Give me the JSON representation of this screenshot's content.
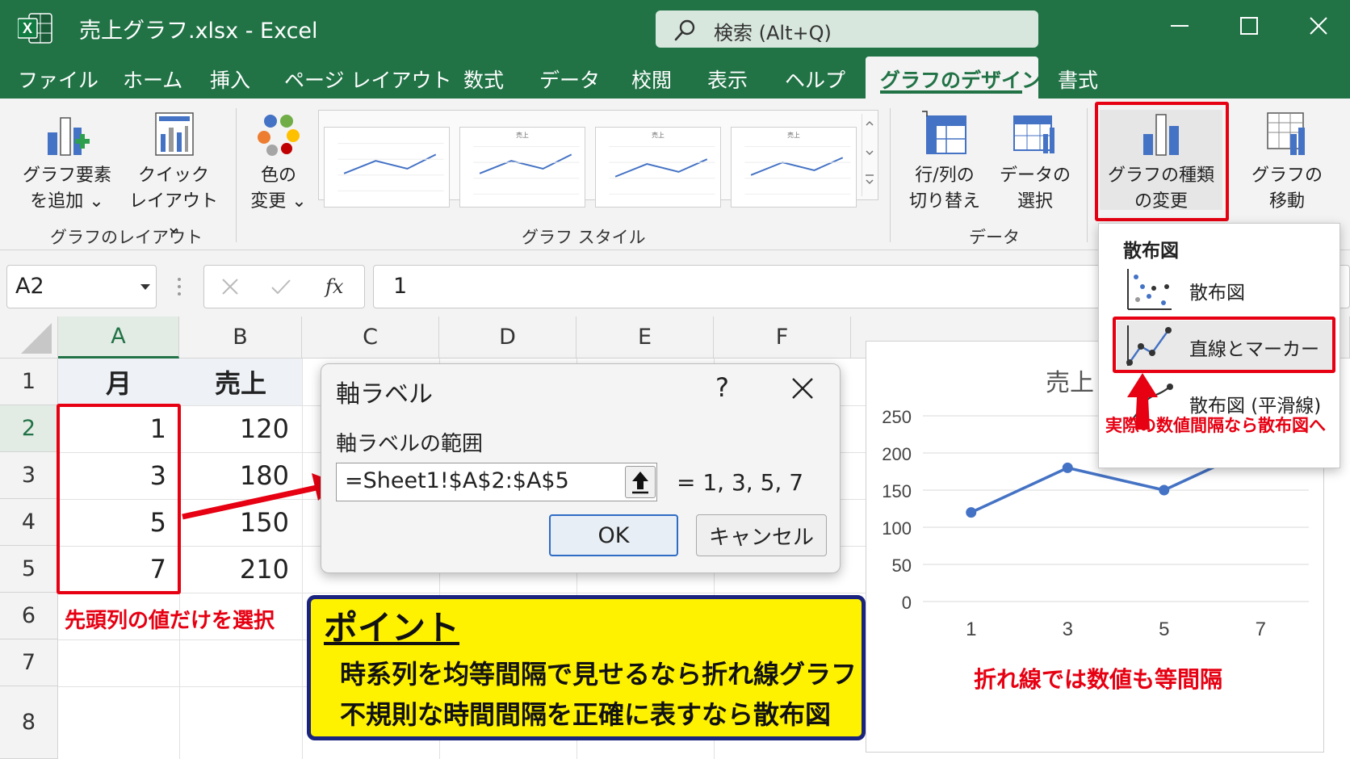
{
  "window": {
    "title": "売上グラフ.xlsx  -  Excel",
    "search_placeholder": "検索 (Alt+Q)"
  },
  "tabs": [
    {
      "label": "ファイル"
    },
    {
      "label": "ホーム"
    },
    {
      "label": "挿入"
    },
    {
      "label": "ページ レイアウト"
    },
    {
      "label": "数式"
    },
    {
      "label": "データ"
    },
    {
      "label": "校閲"
    },
    {
      "label": "表示"
    },
    {
      "label": "ヘルプ"
    },
    {
      "label": "グラフのデザイン",
      "active": true
    },
    {
      "label": "書式"
    }
  ],
  "ribbon": {
    "add_element": {
      "line1": "グラフ要素",
      "line2": "を追加 ⌄"
    },
    "quick_layout": {
      "line1": "クイック",
      "line2": "レイアウト ⌄"
    },
    "change_colors": {
      "line1": "色の",
      "line2": "変更 ⌄"
    },
    "style_thumb_title": "売上",
    "switch_row_col": {
      "line1": "行/列の",
      "line2": "切り替え"
    },
    "select_data": {
      "line1": "データの",
      "line2": "選択"
    },
    "change_chart_type": {
      "line1": "グラフの種類",
      "line2": "の変更"
    },
    "move_chart": {
      "line1": "グラフの",
      "line2": "移動"
    },
    "group_layout": "グラフのレイアウト",
    "group_styles": "グラフ スタイル",
    "group_data": "データ"
  },
  "formula_bar": {
    "name_box": "A2",
    "formula": "1"
  },
  "sheet": {
    "columns": [
      "A",
      "B",
      "C",
      "D",
      "E",
      "F"
    ],
    "rows": [
      "1",
      "2",
      "3",
      "4",
      "5",
      "6",
      "7",
      "8"
    ],
    "header": {
      "A": "月",
      "B": "売上"
    },
    "data": [
      {
        "A": "1",
        "B": "120"
      },
      {
        "A": "3",
        "B": "180"
      },
      {
        "A": "5",
        "B": "150"
      },
      {
        "A": "7",
        "B": "210"
      }
    ]
  },
  "dialog": {
    "title": "軸ラベル",
    "help": "?",
    "label": "軸ラベルの範囲",
    "range_value": "=Sheet1!$A$2:$A$5",
    "preview": "= 1, 3, 5, 7",
    "ok": "OK",
    "cancel": "キャンセル"
  },
  "annotations": {
    "select_note": "先頭列の値だけを選択",
    "scatter_note": "実際の数値間隔なら散布図へ",
    "line_note": "折れ線では数値も等間隔",
    "point_title": "ポイント",
    "point_line1": "時系列を均等間隔で見せるなら折れ線グラフ",
    "point_line2": "不規則な時間間隔を正確に表すなら散布図"
  },
  "dropdown": {
    "header": "散布図",
    "items": [
      {
        "label": "散布図"
      },
      {
        "label": "直線とマーカー",
        "highlighted": true
      },
      {
        "label": "散布図 (平滑線)"
      }
    ]
  },
  "colors": {
    "excel_green": "#217346",
    "highlight_red": "#e60012",
    "callout_yellow": "#fff200",
    "series_blue": "#4472c4"
  },
  "chart_data": {
    "type": "line",
    "title": "売上",
    "categories": [
      "1",
      "3",
      "5",
      "7"
    ],
    "series": [
      {
        "values": [
          120,
          180,
          150,
          210
        ]
      }
    ],
    "ylim": [
      0,
      250
    ],
    "yticks": [
      0,
      50,
      100,
      150,
      200,
      250
    ],
    "grid": true,
    "legend": "none"
  }
}
